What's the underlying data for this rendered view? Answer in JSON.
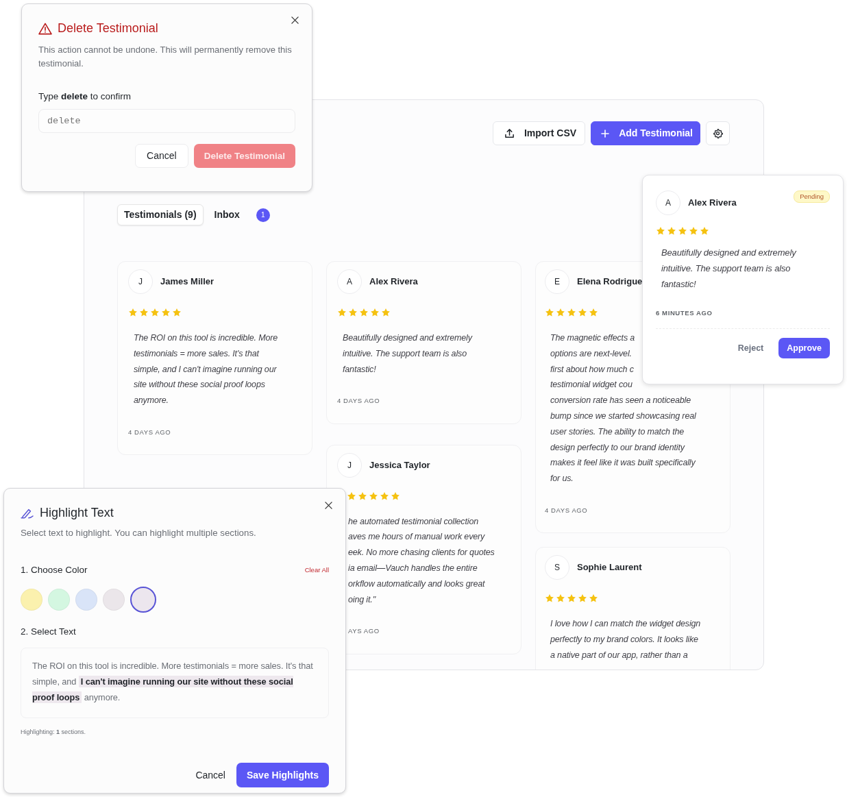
{
  "toolbar": {
    "buttons": [
      {
        "kind": "import",
        "label": "Import CSV"
      },
      {
        "kind": "add",
        "label": "Add Testimonial"
      },
      {
        "kind": "settings"
      }
    ]
  },
  "tabs": [
    {
      "label": "Testimonials (9)",
      "selected": true
    },
    {
      "label": "Inbox",
      "selected": false,
      "badge": "1"
    }
  ],
  "testimonial_columns": [
    {
      "cards": [
        {
          "initial": "J",
          "name": "James Miller",
          "stars": 5,
          "quote_lines": [
            "The ROI on this tool is incredible. More",
            "testimonials = more sales. It's that",
            "simple, and I can't imagine running our",
            "site without these social proof loops",
            "anymore."
          ],
          "time": "4 DAYS AGO"
        }
      ]
    },
    {
      "cards": [
        {
          "initial": "A",
          "name": "Alex Rivera",
          "stars": 5,
          "quote_lines": [
            "Beautifully designed and extremely",
            "intuitive. The support team is also",
            "fantastic!"
          ],
          "time": "4 DAYS AGO"
        },
        {
          "initial": "J",
          "name": "Jessica Taylor",
          "stars": 5,
          "quote_lines": [
            "he automated testimonial collection",
            "aves me hours of manual work every",
            "eek. No more chasing clients for quotes",
            "ia email—Vauch handles the entire",
            "orkflow automatically and looks great",
            "oing it.\""
          ],
          "time": "AYS AGO"
        }
      ]
    },
    {
      "cards": [
        {
          "initial": "E",
          "name": "Elena Rodrigue",
          "stars": 5,
          "quote_lines": [
            "The magnetic effects a",
            "options are next-level.",
            "first about how much c",
            "testimonial widget cou",
            "conversion rate has seen a noticeable",
            "bump since we started showcasing real",
            "user stories. The ability to match the",
            "design perfectly to our brand identity",
            "makes it feel like it was built specifically",
            "for us."
          ],
          "time": "4 DAYS AGO"
        },
        {
          "initial": "S",
          "name": "Sophie Laurent",
          "stars": 5,
          "quote_lines": [
            "I love how I can match the widget design",
            "perfectly to my brand colors. It looks like",
            "a native part of our app, rather than a"
          ]
        }
      ]
    }
  ],
  "pending_card": {
    "initial": "A",
    "name": "Alex Rivera",
    "status": "Pending",
    "stars": 5,
    "quote_lines": [
      "Beautifully designed and extremely",
      "intuitive. The support team is also",
      "fantastic!"
    ],
    "time": "6 MINUTES AGO",
    "buttons": [
      {
        "kind": "secondary",
        "label": "Reject"
      },
      {
        "kind": "primary",
        "label": "Approve"
      }
    ]
  },
  "delete_dialog": {
    "title": "Delete Testimonial",
    "description": "This action cannot be undone. This will permanently remove this testimonial.",
    "confirm_label": "Type **delete** to confirm",
    "input": {
      "placeholder": "delete"
    },
    "buttons": [
      {
        "kind": "secondary",
        "label": "Cancel"
      },
      {
        "kind": "danger",
        "label": "Delete Testimonial",
        "disabled": true
      }
    ]
  },
  "highlight_dialog": {
    "title": "Highlight Text",
    "subtitle": "Select text to highlight. You can highlight multiple sections.",
    "step_1": "1. Choose Color",
    "clear_label": "Clear All",
    "swatches": [
      {
        "color": "#fbf1ae",
        "selected": false
      },
      {
        "color": "#d4f7e1",
        "selected": false
      },
      {
        "color": "#d9e4f8",
        "selected": false
      },
      {
        "color": "#ebe6ea",
        "selected": false
      },
      {
        "color": "#ece6ee",
        "selected": true
      }
    ],
    "step_2": "2. Select Text",
    "passage": [
      {
        "text": "The ROI on this tool is incredible. More testimonials = more sales. It's that simple, and",
        "highlighted": false
      },
      {
        "text": "I can't imagine running our site without these social proof loops",
        "highlighted": true
      },
      {
        "text": "anymore.",
        "highlighted": false
      }
    ],
    "count_text": "Highlighting: **1** sections.",
    "buttons": [
      {
        "kind": "secondary",
        "label": "Cancel"
      },
      {
        "kind": "primary",
        "label": "Save Highlights"
      }
    ]
  }
}
